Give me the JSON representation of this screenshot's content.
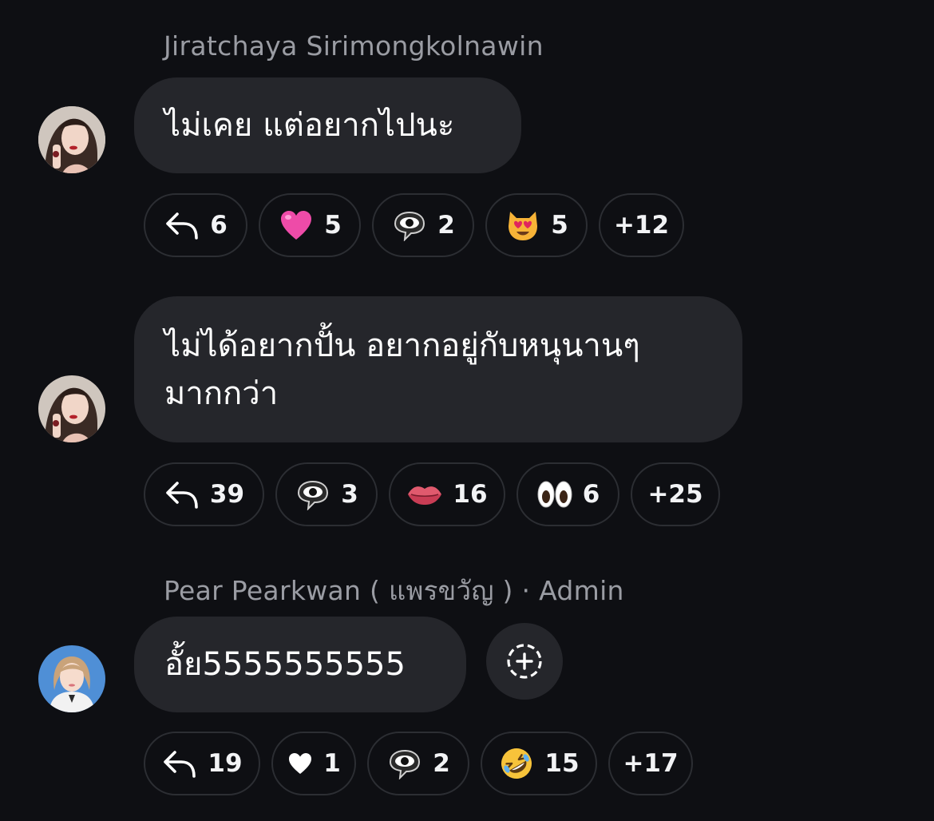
{
  "colors": {
    "background": "#0e0f13",
    "bubble": "#25262b",
    "pill_border": "#2c2e33",
    "sender_text": "#9a9ca3"
  },
  "messages": [
    {
      "sender": "Jiratchaya Sirimongkolnawin",
      "text": "ไม่เคย แต่อยากไปนะ",
      "reactions": [
        {
          "icon": "reply-icon",
          "count": "6"
        },
        {
          "icon": "pink-heart-emoji-icon",
          "count": "5"
        },
        {
          "icon": "eye-in-speech-bubble-emoji-icon",
          "count": "2"
        },
        {
          "icon": "heart-eyes-cat-emoji-icon",
          "count": "5"
        },
        {
          "icon": "",
          "count": "+12"
        }
      ]
    },
    {
      "text": "ไม่ได้อยากปั้น อยากอยู่กับหนุนานๆ\nมากกว่า",
      "reactions": [
        {
          "icon": "reply-icon",
          "count": "39"
        },
        {
          "icon": "eye-in-speech-bubble-emoji-icon",
          "count": "3"
        },
        {
          "icon": "lips-emoji-icon",
          "count": "16"
        },
        {
          "icon": "eyes-emoji-icon",
          "count": "6"
        },
        {
          "icon": "",
          "count": "+25"
        }
      ]
    },
    {
      "sender": "Pear Pearkwan ( แพรขวัญ ) · Admin",
      "text": "อั้ย5555555555",
      "reactions": [
        {
          "icon": "reply-icon",
          "count": "19"
        },
        {
          "icon": "white-heart-icon",
          "count": "1"
        },
        {
          "icon": "eye-in-speech-bubble-emoji-icon",
          "count": "2"
        },
        {
          "icon": "rofl-emoji-icon",
          "count": "15"
        },
        {
          "icon": "",
          "count": "+17"
        }
      ]
    }
  ]
}
